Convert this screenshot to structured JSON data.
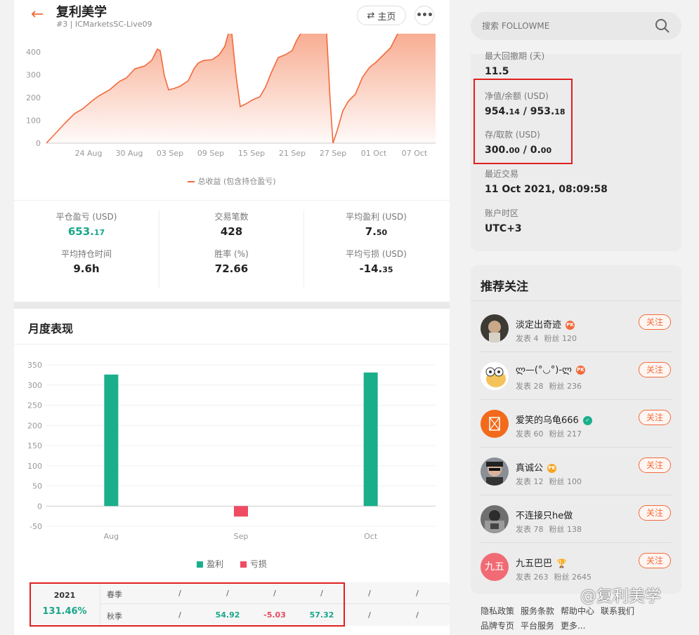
{
  "header": {
    "title": "复利美学",
    "subtitle": "#3 | ICMarketsSC-Live09",
    "home_label": "主页",
    "more_label": "•••"
  },
  "line_chart": {
    "y_ticks": [
      "0",
      "100",
      "200",
      "300",
      "400"
    ],
    "x_ticks": [
      "24 Aug",
      "30 Aug",
      "03 Sep",
      "09 Sep",
      "15 Sep",
      "21 Sep",
      "27 Sep",
      "01 Oct",
      "07 Oct"
    ],
    "legend": "总收益 (包含持仓盈亏)",
    "color": "#f26a3b"
  },
  "stats": {
    "closed_pl_label": "平仓盈亏 (USD)",
    "closed_pl_int": "653.",
    "closed_pl_dec": "17",
    "trades_label": "交易笔数",
    "trades_val": "428",
    "avg_profit_label": "平均盈利 (USD)",
    "avg_profit_int": "7.",
    "avg_profit_dec": "50",
    "avg_hold_label": "平均持仓时间",
    "avg_hold_val": "9.6h",
    "win_rate_label": "胜率 (%)",
    "win_rate_val": "72.66",
    "avg_loss_label": "平均亏损 (USD)",
    "avg_loss_int": "-14.",
    "avg_loss_dec": "35"
  },
  "monthly": {
    "title": "月度表现",
    "legend_profit": "盈利",
    "legend_loss": "亏损",
    "profit_color": "#1aaf8b",
    "loss_color": "#ef4b62"
  },
  "chart_data": {
    "type": "bar",
    "categories": [
      "Aug",
      "Sep",
      "Oct"
    ],
    "series": [
      {
        "name": "盈利",
        "values": [
          326,
          0,
          331
        ]
      },
      {
        "name": "亏损",
        "values": [
          0,
          -26,
          0
        ]
      }
    ],
    "y_ticks": [
      "350",
      "300",
      "250",
      "200",
      "150",
      "100",
      "50",
      "0",
      "-50"
    ],
    "ylim": [
      -50,
      350
    ]
  },
  "perf_table": {
    "year": "2021",
    "pct": "131.46%",
    "row1": {
      "season": "春季",
      "cells": [
        "/",
        "/",
        "/",
        "/",
        "/",
        "/"
      ]
    },
    "row2": {
      "season": "秋季",
      "cells": [
        "/",
        "54.92",
        "-5.03",
        "57.32",
        "/",
        "/"
      ]
    }
  },
  "search": {
    "placeholder": "搜索 FOLLOWME"
  },
  "info": {
    "max_dd_label": "最大回撤期 (天)",
    "max_dd_val": "11.5",
    "equity_label": "净值/余额 (USD)",
    "equity_int": "954.",
    "equity_dec": "14",
    "balance_int": "953.",
    "balance_dec": "18",
    "deposit_label": "存/取款 (USD)",
    "deposit_int": "300.",
    "deposit_dec": "00",
    "withdraw_int": "0.",
    "withdraw_dec": "00",
    "last_trade_label": "最近交易",
    "last_trade_val": "11 Oct 2021, 08:09:58",
    "tz_label": "账户时区",
    "tz_val": "UTC+3"
  },
  "recommend": {
    "title": "推荐关注",
    "follow_label": "关注",
    "items": [
      {
        "name": "淡定出奇迹",
        "posts": "发表 4",
        "fans": "粉丝 120",
        "badge_color": "#f26a3b"
      },
      {
        "name": "ლ—(°◡°)-ლ",
        "posts": "发表 28",
        "fans": "粉丝 236",
        "badge_color": "#f26a3b"
      },
      {
        "name": "爱笑的乌龟666",
        "posts": "发表 60",
        "fans": "粉丝 217",
        "badge_color": "#1aaf8b"
      },
      {
        "name": "真诚公",
        "posts": "发表 12",
        "fans": "粉丝 100",
        "badge_color": "#f5a623"
      },
      {
        "name": "不连接只he做",
        "posts": "发表 78",
        "fans": "粉丝 138",
        "badge_color": ""
      },
      {
        "name": "九五巴巴",
        "posts": "发表 263",
        "fans": "粉丝 2645",
        "badge_color": "#e6b422",
        "avatar_text": "九五"
      }
    ]
  },
  "footer": {
    "links": [
      "隐私政策",
      "服务条款",
      "帮助中心",
      "联系我们",
      "品牌专页",
      "平台服务",
      "更多..."
    ]
  },
  "watermark": "@复利美学"
}
